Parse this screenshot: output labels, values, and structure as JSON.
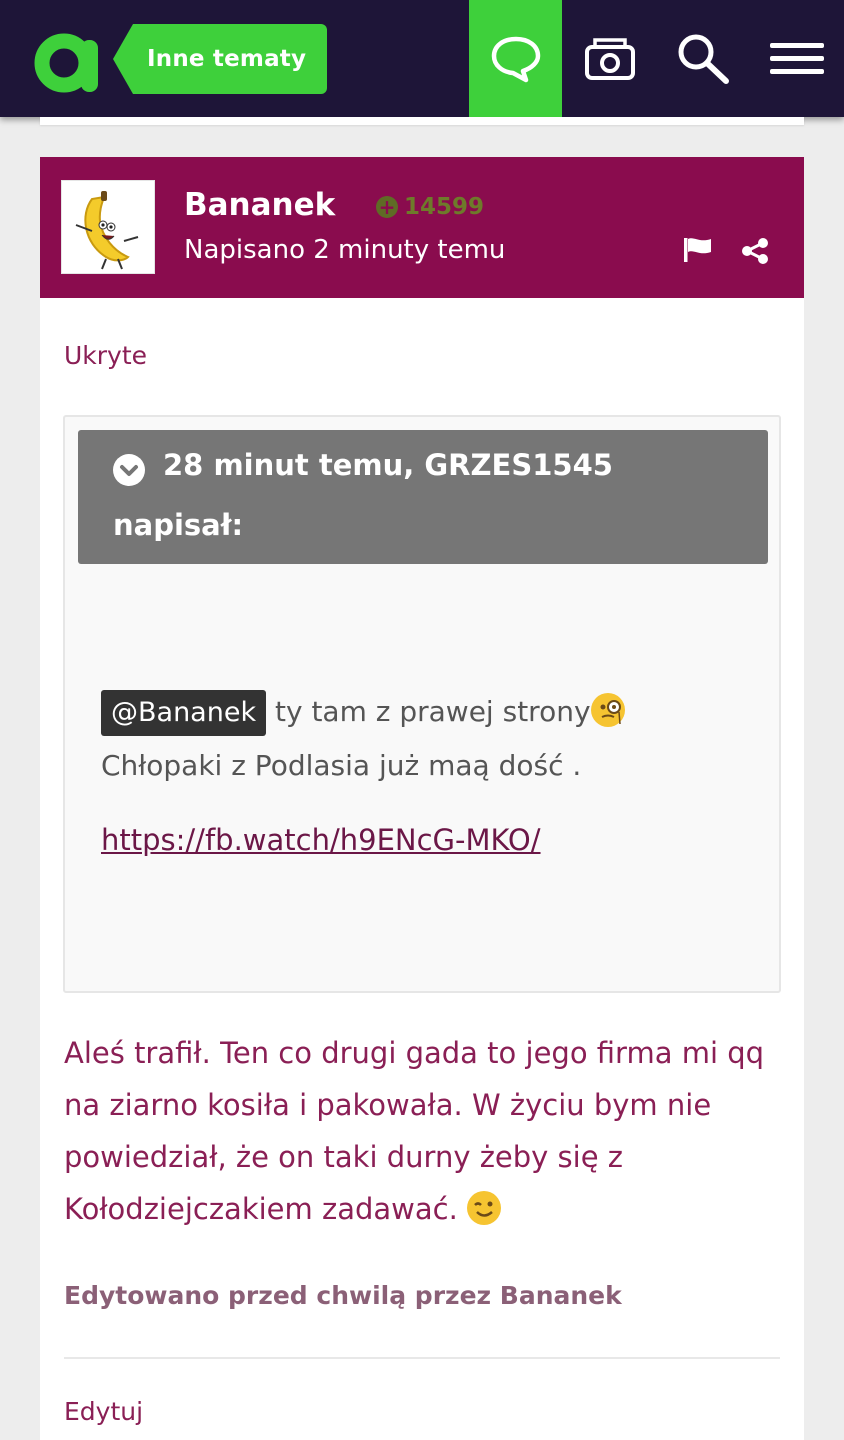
{
  "header": {
    "section": "Inne tematy",
    "colors": {
      "bar": "#1e1538",
      "accent": "#3ed03b"
    },
    "icons": [
      "logo-icon",
      "chat-icon",
      "camera-icon",
      "search-icon",
      "menu-icon"
    ]
  },
  "post": {
    "author": "Bananek",
    "reputation": "14599",
    "posted": "Napisano 2 minuty temu",
    "header_color": "#8a0c4e",
    "hidden_label": "Ukryte",
    "quote": {
      "line1": "28 minut temu, GRZES1545",
      "line2": "napisał:",
      "mention": "@Bananek",
      "text1": "ty tam z prawej strony",
      "text2": "Chłopaki z Podlasia już maą dość .",
      "link": "https://fb.watch/h9ENcG-MKO/"
    },
    "body": "Aleś trafił. Ten co drugi gada to jego firma mi qq na ziarno kosiła i pakowała. W życiu bym nie powiedział, że on taki durny żeby się z Kołodziejczakiem zadawać.",
    "edited": "Edytowano przed chwilą przez Bananek",
    "edit_action": "Edytuj"
  }
}
